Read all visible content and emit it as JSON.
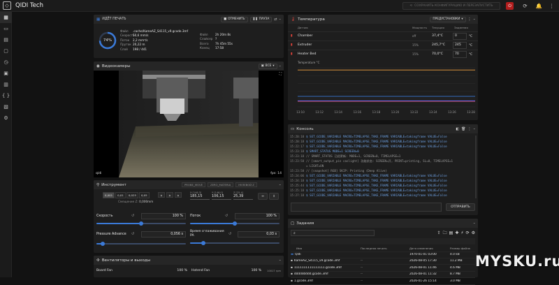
{
  "app": {
    "title": "QIDI Tech",
    "logo_icon": "qidi-logo-icon"
  },
  "topbar": {
    "save_button": "СОХРАНИТЬ КОНФИГУРАЦИЮ И ПЕРЕЗАПУСТИТЬ",
    "estop_icon": "emergency-stop-icon",
    "icons": [
      "refresh-icon",
      "bell-icon",
      "dots-vertical-icon"
    ]
  },
  "sidebar": {
    "items": [
      "dashboard-icon",
      "console-icon",
      "heightmap-icon",
      "files-icon",
      "history-icon",
      "timelapse-icon",
      "machine-icon",
      "macros-icon",
      "config-icon",
      "settings-icon"
    ]
  },
  "print_status": {
    "badge": "ИДЁТ ПЕЧАТЬ",
    "cancel_button": "ОТМЕНИТЬ",
    "pause_button": "ПАУЗА",
    "progress_text": "74%",
    "progress_fraction": 0.74,
    "left": [
      {
        "label": "Файл",
        "value": ".cache/KameAZ_S4115_v9.gcode.3mf"
      },
      {
        "label": "Скорость",
        "value": "50,6 mm/s"
      },
      {
        "label": "Поток",
        "value": "2,2 mm³/s"
      },
      {
        "label": "Пруток",
        "value": "20,22 m"
      },
      {
        "label": "Слой",
        "value": "198 / 441"
      }
    ],
    "right": [
      {
        "label": "Файл",
        "value": "2h 20m 8s"
      },
      {
        "label": "Слайсер",
        "value": "?"
      },
      {
        "label": "Всего",
        "value": "7h 45m 55s"
      },
      {
        "label": "Конец",
        "value": "17:58"
      }
    ]
  },
  "webcam": {
    "title": "Видеокамеры",
    "selector": "ВСЕ",
    "label": "qidi",
    "fps": "fps: 14"
  },
  "toolhead": {
    "title": "Инструмент",
    "steps": [
      "0,001",
      "0,01",
      "0,025",
      "0,05"
    ],
    "active_step_index": 0,
    "zoffset_label": "Смещение Z",
    "zoffset_value": "0,000mm",
    "home_buttons": [
      "X",
      "Y",
      "Z"
    ],
    "buttons": [
      "PROBE_MOVE",
      "ZERO_MATERIA",
      "НУЛЕВОЙ Z"
    ],
    "pos": [
      {
        "label": "X [146,3]",
        "value": "185,15"
      },
      {
        "label": "Y [146,0]",
        "value": "106,15"
      },
      {
        "label": "Z [25,4]",
        "value": "25,39"
      }
    ],
    "speed_label": "Скорость",
    "speed_value": "100 %",
    "speed_fraction": 0.5,
    "flow_label": "Поток",
    "flow_value": "100 %",
    "flow_fraction": 0.5,
    "pa_label": "Pressure Advance",
    "pa_value": "0,056 s",
    "pa_fraction": 0.07,
    "smooth_label": "Время сглаживания PA",
    "smooth_value": "0,03 s",
    "smooth_fraction": 0.15
  },
  "fans": {
    "title": "Вентиляторы и выходы",
    "items": [
      {
        "label": "Board Fan",
        "value": "100 %"
      },
      {
        "label": "Hotend Fan",
        "value": "100 %",
        "extra": "10017 rpm"
      }
    ]
  },
  "temperature": {
    "title": "Температура",
    "preset_button": "ПРЕДУСТАНОВКИ",
    "columns": [
      "Датчик",
      "Мощность",
      "Текущая",
      "Заданная"
    ],
    "rows": [
      {
        "name": "Chamber",
        "power": "off",
        "current": "37,4°C",
        "target": "0",
        "unit": "°C",
        "color": "#e8453c",
        "icon": "chamber-icon"
      },
      {
        "name": "Extruder",
        "power": "15%",
        "current": "245,7°C",
        "target": "245",
        "unit": "°C",
        "color": "#e8453c",
        "icon": "extruder-icon"
      },
      {
        "name": "Heater Bed",
        "power": "15%",
        "current": "70,0°C",
        "target": "70",
        "unit": "°C",
        "color": "#e8453c",
        "icon": "heater-bed-icon"
      }
    ],
    "chart_ylabel": "Temperature °C",
    "chart_times": [
      "13:10",
      "13:12",
      "13:14",
      "13:16",
      "13:18",
      "13:20",
      "13:22",
      "13:24",
      "13:26",
      "13:28"
    ],
    "chart_lines": [
      {
        "value": 245,
        "color": "#f0a040"
      },
      {
        "value": 70,
        "color": "#3b7ad8"
      },
      {
        "value": 37,
        "color": "#e8453c"
      },
      {
        "value": 40,
        "color": "#6a6aff"
      }
    ]
  },
  "console": {
    "title": "Консоль",
    "send_button": "ОТПРАВИТЬ",
    "lines": [
      {
        "t": "15:20:10",
        "c": "$ SET_GCODE_VARIABLE MACRO=TIMELAPSE_TAKE_FRAME VARIABLE=takingframe VALUE=False",
        "g": false
      },
      {
        "t": "15:20:18",
        "c": "$ SET_GCODE_VARIABLE MACRO=TIMELAPSE_TAKE_FRAME VARIABLE=takingframe VALUE=False",
        "g": false
      },
      {
        "t": "15:22:17",
        "c": "$ SET_GCODE_VARIABLE MACRO=TIMELAPSE_TAKE_FRAME VARIABLE=takingframe VALUE=False",
        "g": false
      },
      {
        "t": "15:23:18",
        "c": "$ SMART_STATUS MODE=1 SCREEN=0",
        "g": false
      },
      {
        "t": "15:23:18",
        "c": "// SMART_STATUS 已经更新: MODE=1, SCREEN=0, TIMELAPSE=1",
        "g": true
      },
      {
        "t": "15:23:58",
        "c": "// [smart_output_pin caslight] 功能状态: SCREEN=开, PRINT=printing, SL=0, TIMELAPSE=1",
        "g": true
      },
      {
        "t": "",
        "c": "= LIGHT=ON",
        "g": true
      },
      {
        "t": "15:23:58",
        "c": "// [snapshot] RGB] SKIP: Printing (Deep Alive)",
        "g": true
      },
      {
        "t": "15:24:06",
        "c": "$ SET_GCODE_VARIABLE MACRO=TIMELAPSE_TAKE_FRAME VARIABLE=takingframe VALUE=False",
        "g": false
      },
      {
        "t": "15:24:18",
        "c": "$ SET_GCODE_VARIABLE MACRO=TIMELAPSE_TAKE_FRAME VARIABLE=takingframe VALUE=False",
        "g": false
      },
      {
        "t": "15:25:44",
        "c": "$ SET_GCODE_VARIABLE MACRO=TIMELAPSE_TAKE_FRAME VARIABLE=takingframe VALUE=False",
        "g": false
      },
      {
        "t": "15:25:18",
        "c": "$ SET_GCODE_VARIABLE MACRO=TIMELAPSE_TAKE_FRAME VARIABLE=takingframe VALUE=False",
        "g": false
      },
      {
        "t": "15:27:18",
        "c": "$ SET_GCODE_VARIABLE MACRO=TIMELAPSE_TAKE_FRAME VARIABLE=takingframe VALUE=False",
        "g": false
      }
    ]
  },
  "files": {
    "title": "Задания",
    "columns": [
      "Имя",
      "Последняя печать",
      "Дата изменения",
      "Размер файла"
    ],
    "rows": [
      {
        "icon": "folder-icon",
        "name": "Qidi",
        "last": "",
        "date": "1970-01-01 03:00",
        "size": "4.0 kB"
      },
      {
        "icon": "file-icon",
        "name": "KameAZ_S4115_v9.gcode.3mf",
        "last": "--",
        "date": "2026-08-05 17:30",
        "size": "11.2 MB"
      },
      {
        "icon": "file-icon",
        "name": "1111111111111111.gcode.3mf",
        "last": "--",
        "date": "2026-08-01 11:46",
        "size": "4.6 MB"
      },
      {
        "icon": "file-icon",
        "name": "ddddddddd.gcode.3mf",
        "last": "--",
        "date": "2026-08-01 11:32",
        "size": "8.7 MB"
      },
      {
        "icon": "file-icon",
        "name": "1.gcode.3mf",
        "last": "--",
        "date": "2026-01-26 15:14",
        "size": "3.0 MB"
      }
    ]
  },
  "watermark": "MYSKU.ru"
}
